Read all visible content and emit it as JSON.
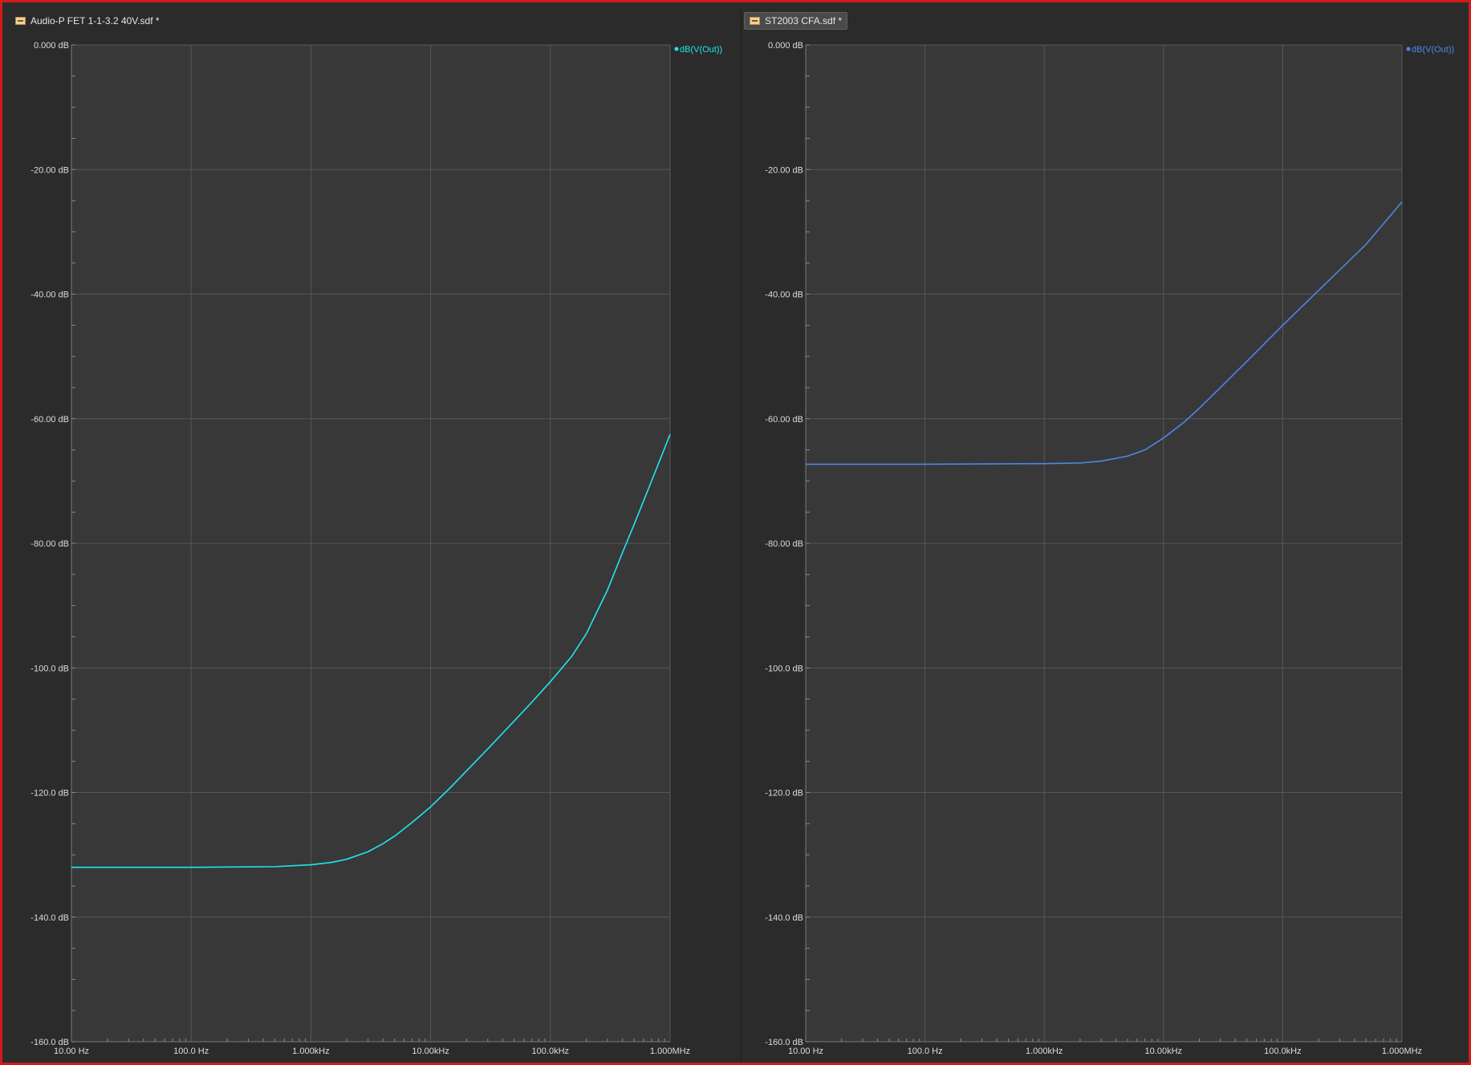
{
  "window": {
    "tabs": [
      {
        "label": "Audio-P FET 1-1-3.2 40V.sdf *",
        "active": false
      },
      {
        "label": "ST2003 CFA.sdf *",
        "active": true
      }
    ]
  },
  "colors": {
    "background": "#2b2b2b",
    "plot_area": "#383838",
    "grid": "#575757",
    "frame_border": "#d21a1a",
    "trace_left": "#1fe6f0",
    "trace_right": "#4d86e6"
  },
  "chart_data": [
    {
      "type": "line",
      "title": "",
      "xlabel": "",
      "ylabel": "",
      "x_scale": "log",
      "xlim": [
        10,
        1000000
      ],
      "ylim": [
        -160,
        0
      ],
      "grid": true,
      "legend_position": "top-right",
      "x_ticks": [
        "10.00 Hz",
        "100.0 Hz",
        "1.000kHz",
        "10.00kHz",
        "100.0kHz",
        "1.000MHz"
      ],
      "y_ticks": [
        "0.000 dB",
        "-20.00 dB",
        "-40.00 dB",
        "-60.00 dB",
        "-80.00 dB",
        "-100.0 dB",
        "-120.0 dB",
        "-140.0 dB",
        "-160.0 dB"
      ],
      "series": [
        {
          "name": "dB(V(Out))",
          "color": "#1fe6f0",
          "x": [
            10,
            100,
            500,
            1000,
            1500,
            2000,
            3000,
            4000,
            5000,
            7000,
            10000,
            15000,
            20000,
            30000,
            50000,
            70000,
            100000,
            150000,
            200000,
            300000,
            400000,
            500000,
            700000,
            1000000
          ],
          "y": [
            -132,
            -132,
            -131.9,
            -131.6,
            -131.2,
            -130.7,
            -129.5,
            -128.2,
            -127,
            -124.8,
            -122.3,
            -119,
            -116.5,
            -113,
            -108.5,
            -105.5,
            -102.2,
            -98.2,
            -94.5,
            -87.5,
            -81.5,
            -77,
            -70,
            -62.5
          ]
        }
      ]
    },
    {
      "type": "line",
      "title": "",
      "xlabel": "",
      "ylabel": "",
      "x_scale": "log",
      "xlim": [
        10,
        1000000
      ],
      "ylim": [
        -160,
        0
      ],
      "grid": true,
      "legend_position": "top-right",
      "x_ticks": [
        "10.00 Hz",
        "100.0 Hz",
        "1.000kHz",
        "10.00kHz",
        "100.0kHz",
        "1.000MHz"
      ],
      "y_ticks": [
        "0.000 dB",
        "-20.00 dB",
        "-40.00 dB",
        "-60.00 dB",
        "-80.00 dB",
        "-100.0 dB",
        "-120.0 dB",
        "-140.0 dB",
        "-160.0 dB"
      ],
      "series": [
        {
          "name": "dB(V(Out))",
          "color": "#4d86e6",
          "x": [
            10,
            100,
            1000,
            2000,
            3000,
            5000,
            7000,
            10000,
            15000,
            20000,
            30000,
            50000,
            100000,
            200000,
            500000,
            1000000
          ],
          "y": [
            -67.3,
            -67.3,
            -67.2,
            -67.1,
            -66.8,
            -66,
            -65,
            -63.1,
            -60.5,
            -58.3,
            -55,
            -50.8,
            -45,
            -39.4,
            -32,
            -25.2
          ]
        }
      ]
    }
  ]
}
